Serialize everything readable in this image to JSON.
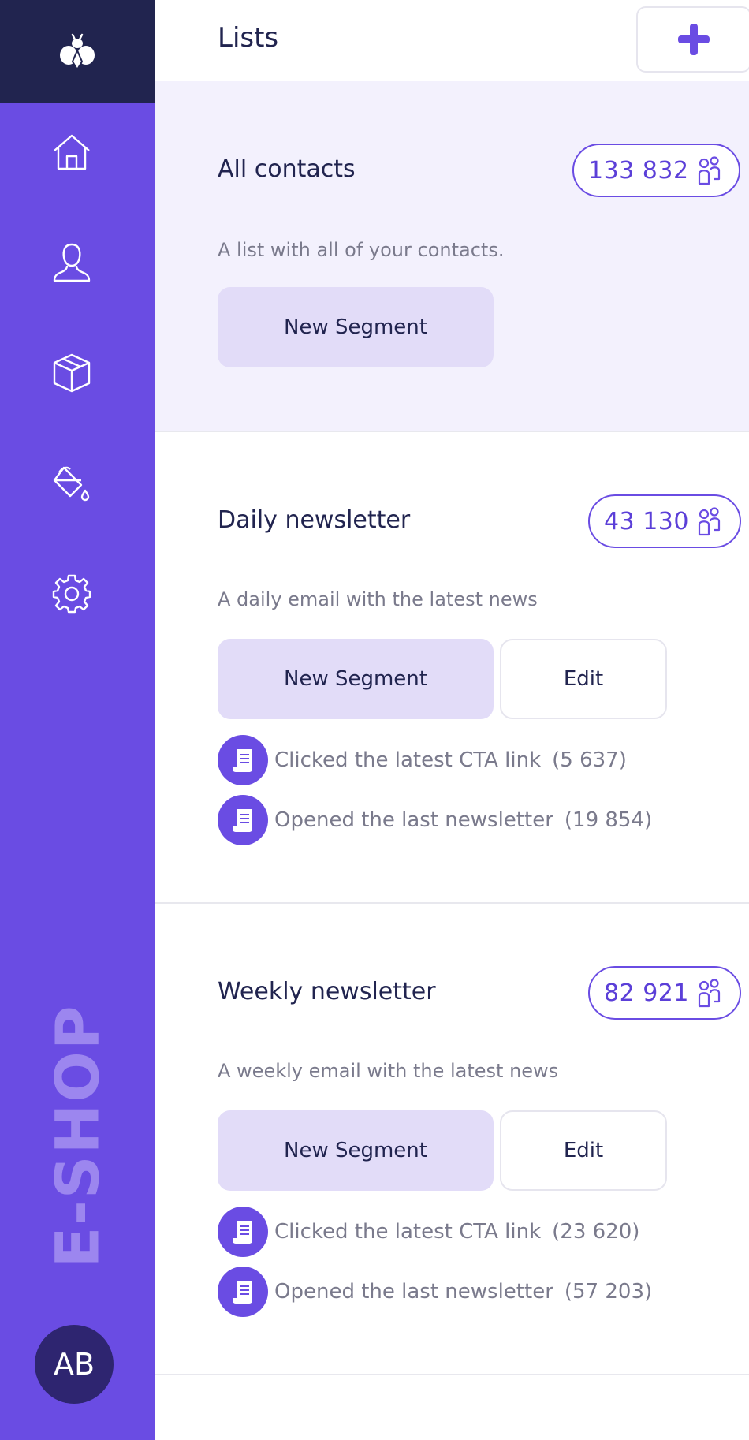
{
  "sidebar": {
    "nav": [
      "home-icon",
      "user-icon",
      "box-icon",
      "paint-bucket-icon",
      "gear-icon"
    ],
    "brand": "E-SHOP",
    "avatar_initials": "AB",
    "colors": {
      "sidebar": "#6a4ce3",
      "logo_bg": "#21244f",
      "brand_text": "#9c86ef",
      "avatar_bg": "#2e2570"
    }
  },
  "header": {
    "title": "Lists",
    "add_icon": "plus-icon"
  },
  "lists": [
    {
      "title": "All contacts",
      "count": "133 832",
      "description": "A list with all of your contacts.",
      "new_segment_label": "New Segment",
      "edit_label": "",
      "segments": []
    },
    {
      "title": "Daily newsletter",
      "count": "43 130",
      "description": "A daily email with the latest news",
      "new_segment_label": "New Segment",
      "edit_label": "Edit",
      "segments": [
        {
          "label": "Clicked the latest CTA link",
          "count": "(5 637)"
        },
        {
          "label": "Opened the last newsletter",
          "count": "(19 854)"
        }
      ]
    },
    {
      "title": "Weekly newsletter",
      "count": "82 921",
      "description": "A weekly email with the latest news",
      "new_segment_label": "New Segment",
      "edit_label": "Edit",
      "segments": [
        {
          "label": "Clicked the latest CTA link",
          "count": "(23 620)"
        },
        {
          "label": "Opened the last newsletter",
          "count": "(57 203)"
        }
      ]
    }
  ],
  "colors": {
    "accent": "#6a4ce3",
    "active_card_bg": "#f3f1fd",
    "segment_button_bg": "#e2dcf8",
    "text_dark": "#21244f",
    "text_muted": "#7a7a8c"
  }
}
